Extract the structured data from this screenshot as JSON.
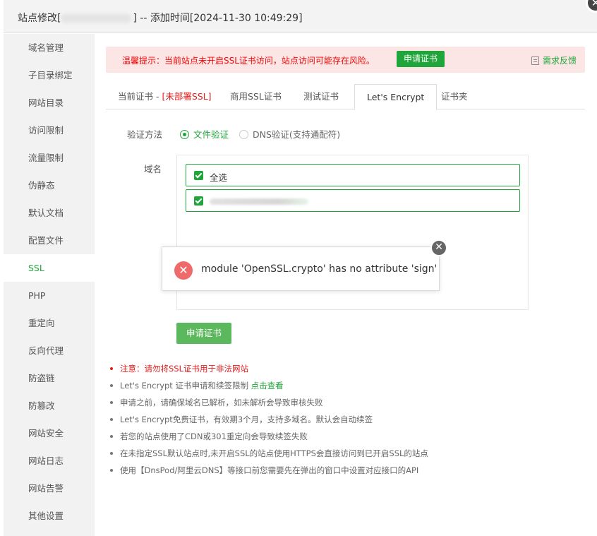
{
  "window": {
    "title_prefix": "站点修改[",
    "title_suffix": "] -- 添加时间[2024-11-30 10:49:29]",
    "close_icon": "✕"
  },
  "sidebar": {
    "items": [
      {
        "label": "域名管理"
      },
      {
        "label": "子目录绑定"
      },
      {
        "label": "网站目录"
      },
      {
        "label": "访问限制"
      },
      {
        "label": "流量限制"
      },
      {
        "label": "伪静态"
      },
      {
        "label": "默认文档"
      },
      {
        "label": "配置文件"
      },
      {
        "label": "SSL",
        "active": true
      },
      {
        "label": "PHP"
      },
      {
        "label": "重定向"
      },
      {
        "label": "反向代理"
      },
      {
        "label": "防盗链"
      },
      {
        "label": "防篡改"
      },
      {
        "label": "网站安全"
      },
      {
        "label": "网站日志"
      },
      {
        "label": "网站告警"
      },
      {
        "label": "其他设置"
      }
    ]
  },
  "alert": {
    "text": "温馨提示：当前站点未开启SSL证书访问，站点访问可能存在风险。",
    "button": "申请证书",
    "feedback": "需求反馈"
  },
  "tabs": {
    "current_prefix": "当前证书 - ",
    "current_status": "[未部署SSL]",
    "commercial": "商用SSL证书",
    "test": "测试证书",
    "letsencrypt": "Let's Encrypt",
    "folder": "证书夹"
  },
  "verify": {
    "label": "验证方法",
    "options": [
      "文件验证",
      "DNS验证(支持通配符)"
    ],
    "selected": "文件验证"
  },
  "domains": {
    "label": "域名",
    "select_all": "全选"
  },
  "apply_button": "申请证书",
  "notes": [
    "注意：请勿将SSL证书用于非法网站",
    "Let's Encrypt 证书申请和续签限制",
    "申请之前，请确保域名已解析，如未解析会导致审核失败",
    "Let's Encrypt免费证书，有效期3个月，支持多域名。默认会自动续签",
    "若您的站点使用了CDN或301重定向会导致续签失败",
    "在未指定SSL默认站点时,未开启SSL的站点使用HTTPS会直接访问到已开启SSL的站点",
    "使用【DnsPod/阿里云DNS】等接口前您需要先在弹出的窗口中设置对应接口的API"
  ],
  "notes_link": "点击查看",
  "error_popup": {
    "message": "module 'OpenSSL.crypto' has no attribute 'sign'",
    "icon": "✕",
    "close": "✕"
  },
  "colors": {
    "accent": "#20a53a",
    "danger": "#e41c1c",
    "alert_bg": "#fbe5e5",
    "error_icon": "#ef6a6a"
  }
}
